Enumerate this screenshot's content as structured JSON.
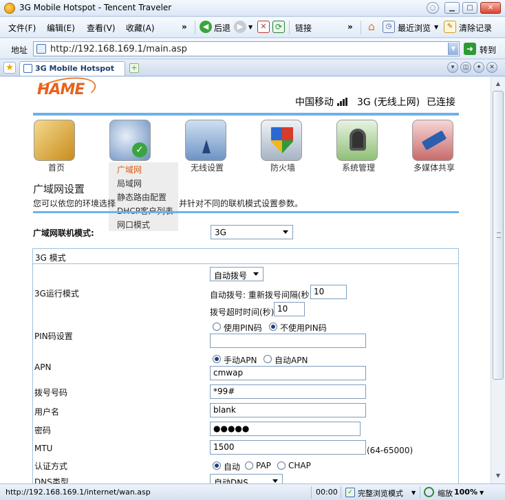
{
  "window": {
    "title": "3G Mobile Hotspot - Tencent Traveler"
  },
  "menu": {
    "file": "文件(F)",
    "edit": "编辑(E)",
    "view": "查看(V)",
    "favorites": "收藏(A)",
    "more1": "»",
    "back": "后退",
    "links": "链接",
    "more2": "»",
    "recent": "最近浏览",
    "clear": "清除记录"
  },
  "address": {
    "label": "地址",
    "url": "http://192.168.169.1/main.asp",
    "go": "转到"
  },
  "tab": {
    "title": "3G Mobile Hotspot"
  },
  "header": {
    "logo": "HAME",
    "carrier": "中国移动",
    "network": "3G (无线上网)",
    "connection": "已连接"
  },
  "nav": [
    {
      "label": "首页",
      "icon": "home-icon"
    },
    {
      "label": "广域网",
      "icon": "globe-check-icon"
    },
    {
      "label": "无线设置",
      "icon": "wireless-icon"
    },
    {
      "label": "防火墙",
      "icon": "firewall-shield-icon"
    },
    {
      "label": "系统管理",
      "icon": "lock-gear-icon"
    },
    {
      "label": "多媒体共享",
      "icon": "usb-share-icon"
    }
  ],
  "submenu": [
    "广域网",
    "局域网",
    "静态路由配置",
    "DHCP客户列表",
    "网口模式"
  ],
  "section": {
    "title": "广域网设置",
    "desc_left": "您可以依您的环境选择",
    "desc_right": "并针对不同的联机模式设置参数。"
  },
  "form": {
    "mode_label": "广域网联机模式:",
    "mode_value": "3G",
    "panel_title": "3G 模式",
    "run_mode_label": "3G运行模式",
    "run_mode_value": "自动拨号",
    "redial_label": "自动拨号: 重新拨号间隔(秒)",
    "redial_value": "10",
    "timeout_label": "拨号超时时间(秒)",
    "timeout_value": "10",
    "pin_label": "PIN码设置",
    "pin_use": "使用PIN码",
    "pin_nouse": "不使用PIN码",
    "pin_value": "",
    "apn_label": "APN",
    "apn_manual": "手动APN",
    "apn_auto": "自动APN",
    "apn_value": "cmwap",
    "dial_label": "拨号号码",
    "dial_value": "*99#",
    "user_label": "用户名",
    "user_value": "blank",
    "pass_label": "密码",
    "pass_value": "●●●●●",
    "mtu_label": "MTU",
    "mtu_value": "1500",
    "mtu_range": "(64-65000)",
    "auth_label": "认证方式",
    "auth_auto": "自动",
    "auth_pap": "PAP",
    "auth_chap": "CHAP",
    "dns_label": "DNS类型",
    "dns_value": "自动DNS"
  },
  "statusbar": {
    "url": "http://192.168.169.1/internet/wan.asp",
    "time": "00:00",
    "mode": "完整浏览模式",
    "zoom_label": "缩放",
    "zoom": "100%"
  }
}
